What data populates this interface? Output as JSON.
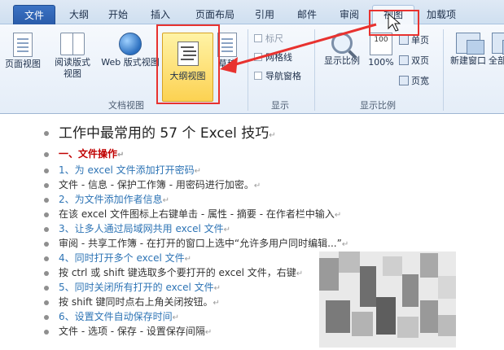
{
  "tabs": [
    "文件",
    "大纲",
    "开始",
    "插入",
    "页面布局",
    "引用",
    "邮件",
    "审阅",
    "视图",
    "加载项"
  ],
  "ribbon": {
    "doc_view_buttons": [
      "页面视图",
      "阅读版式\n视图",
      "Web 版式视图",
      "大纲视图",
      "草稿"
    ],
    "doc_view_group": "文档视图",
    "show_checks": [
      "标尺",
      "网格线",
      "导航窗格"
    ],
    "show_group": "显示",
    "zoom_buttons": [
      "显示比例",
      "100%"
    ],
    "zoom_small": [
      "单页",
      "双页",
      "页宽"
    ],
    "zoom_group": "显示比例",
    "window_buttons": [
      "新建窗口",
      "全部"
    ]
  },
  "document": {
    "title": "工作中最常用的 57 个 Excel 技巧",
    "section": "一、文件操作",
    "items": [
      {
        "text": "1、为 excel 文件添加打开密码",
        "kind": "heading"
      },
      {
        "text": "文件 - 信息 - 保护工作簿 - 用密码进行加密。",
        "kind": "body"
      },
      {
        "text": "2、为文件添加作者信息",
        "kind": "heading"
      },
      {
        "text": "在该 excel 文件图标上右键单击 - 属性 - 摘要 - 在作者栏中输入",
        "kind": "body"
      },
      {
        "text": "3、让多人通过局域网共用 excel 文件",
        "kind": "heading"
      },
      {
        "text": "审阅 - 共享工作簿 - 在打开的窗口上选中“允许多用户同时编辑...”",
        "kind": "body"
      },
      {
        "text": "4、同时打开多个 excel 文件",
        "kind": "heading"
      },
      {
        "text": "按 ctrl 或 shift 键选取多个要打开的 excel 文件，右键",
        "kind": "body"
      },
      {
        "text": "5、同时关闭所有打开的 excel 文件",
        "kind": "heading"
      },
      {
        "text": "按 shift 键同时点右上角关闭按钮。",
        "kind": "body"
      },
      {
        "text": "6、设置文件自动保存时间",
        "kind": "heading"
      },
      {
        "text": "文件 - 选项 - 保存 - 设置保存间隔",
        "kind": "body"
      }
    ],
    "para_mark": "↵"
  },
  "colors": {
    "heading": "#2e74b5",
    "section": "#c00000",
    "body": "#333333",
    "highlight_box": "#e8322f"
  }
}
